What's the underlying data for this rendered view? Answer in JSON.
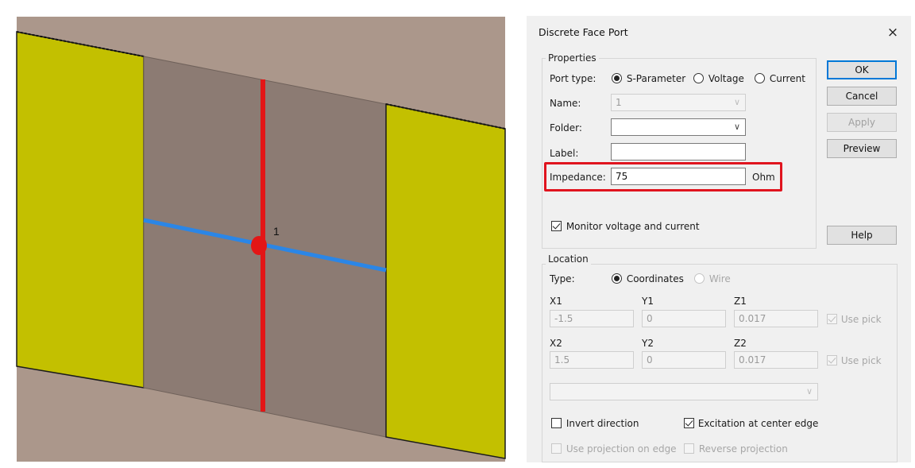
{
  "dialog": {
    "title": "Discrete Face Port",
    "close_glyph": "×",
    "properties": {
      "legend": "Properties",
      "port_type_label": "Port type:",
      "port_type_options": [
        "S-Parameter",
        "Voltage",
        "Current"
      ],
      "port_type_selected": "S-Parameter",
      "name_label": "Name:",
      "name_value": "1",
      "folder_label": "Folder:",
      "folder_value": "",
      "label_label": "Label:",
      "label_value": "",
      "impedance_label": "Impedance:",
      "impedance_value": "75",
      "impedance_unit": "Ohm",
      "monitor_label": "Monitor voltage and current",
      "monitor_checked": true
    },
    "buttons": {
      "ok": "OK",
      "cancel": "Cancel",
      "apply": "Apply",
      "preview": "Preview",
      "help": "Help"
    },
    "location": {
      "legend": "Location",
      "type_label": "Type:",
      "type_options": [
        "Coordinates",
        "Wire"
      ],
      "type_selected": "Coordinates",
      "x1_label": "X1",
      "x1_value": "-1.5",
      "y1_label": "Y1",
      "y1_value": "0",
      "z1_label": "Z1",
      "z1_value": "0.017",
      "x2_label": "X2",
      "x2_value": "1.5",
      "y2_label": "Y2",
      "y2_value": "0",
      "z2_label": "Z2",
      "z2_value": "0.017",
      "use_pick_label": "Use pick",
      "pick_combo_value": "",
      "invert_label": "Invert direction",
      "invert_checked": false,
      "excitation_label": "Excitation at center edge",
      "excitation_checked": true,
      "projection_label": "Use projection on edge",
      "reverse_label": "Reverse projection"
    },
    "highlight_color": "#e0141e"
  },
  "viewport": {
    "port_marker_label": "1",
    "colors": {
      "background": "#ab978b",
      "substrate": "#8c7b73",
      "conductor": "#c3c000",
      "port_line": "#e31616",
      "edge_line": "#2b86e6"
    }
  }
}
